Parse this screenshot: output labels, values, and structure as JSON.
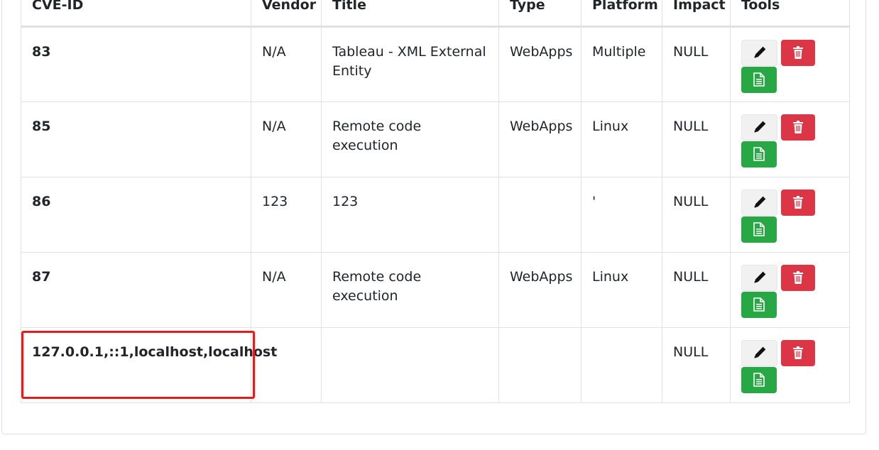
{
  "table": {
    "headers": [
      "CVE-ID",
      "Vendor",
      "Title",
      "Type",
      "Platform",
      "Impact",
      "Tools"
    ],
    "rows": [
      {
        "id": "83",
        "vendor": "N/A",
        "title": "Tableau - XML External Entity",
        "type": "WebApps",
        "platform": "Multiple",
        "impact": "NULL"
      },
      {
        "id": "85",
        "vendor": "N/A",
        "title": "Remote code execution",
        "type": "WebApps",
        "platform": "Linux",
        "impact": "NULL"
      },
      {
        "id": "86",
        "vendor": "123",
        "title": "123",
        "type": "",
        "platform": "'",
        "impact": "NULL"
      },
      {
        "id": "87",
        "vendor": "N/A",
        "title": "Remote code execution",
        "type": "WebApps",
        "platform": "Linux",
        "impact": "NULL"
      },
      {
        "id": "127.0.0.1,::1,localhost,localhost",
        "vendor": "",
        "title": "",
        "type": "",
        "platform": "",
        "impact": "NULL"
      }
    ]
  },
  "tool_icons": {
    "edit": "pencil-icon",
    "delete": "trash-icon",
    "report": "file-text-icon"
  },
  "colors": {
    "delete_button": "#dc3545",
    "report_button": "#28a745",
    "edit_button": "#f1f1f1",
    "highlight_box": "#e51c1c"
  }
}
